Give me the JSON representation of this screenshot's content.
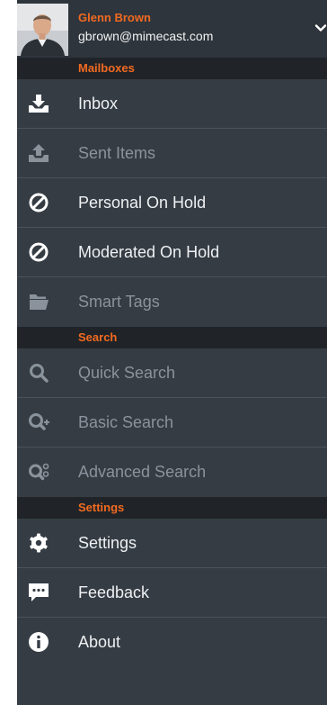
{
  "account": {
    "name": "Glenn Brown",
    "email": "gbrown@mimecast.com"
  },
  "sections": {
    "mailboxes": "Mailboxes",
    "search": "Search",
    "settings": "Settings"
  },
  "mailboxes": {
    "inbox": "Inbox",
    "sent_items": "Sent Items",
    "personal_on_hold": "Personal On Hold",
    "moderated_on_hold": "Moderated On Hold",
    "smart_tags": "Smart Tags"
  },
  "search": {
    "quick_search": "Quick Search",
    "basic_search": "Basic Search",
    "advanced_search": "Advanced Search"
  },
  "settings": {
    "settings": "Settings",
    "feedback": "Feedback",
    "about": "About"
  },
  "colors": {
    "accent": "#f26a21",
    "drawer_bg": "#353c44",
    "section_bg": "#202428",
    "text": "#eef0f2",
    "text_dim": "#8a939c"
  },
  "icons": {
    "inbox": "inbox-download-icon",
    "sent_items": "sent-upload-icon",
    "personal_on_hold": "prohibited-icon",
    "moderated_on_hold": "prohibited-icon",
    "smart_tags": "folder-icon",
    "quick_search": "magnifier-icon",
    "basic_search": "magnifier-plus-icon",
    "advanced_search": "magnifier-options-icon",
    "settings": "gear-icon",
    "feedback": "speech-bubble-icon",
    "about": "info-icon"
  }
}
